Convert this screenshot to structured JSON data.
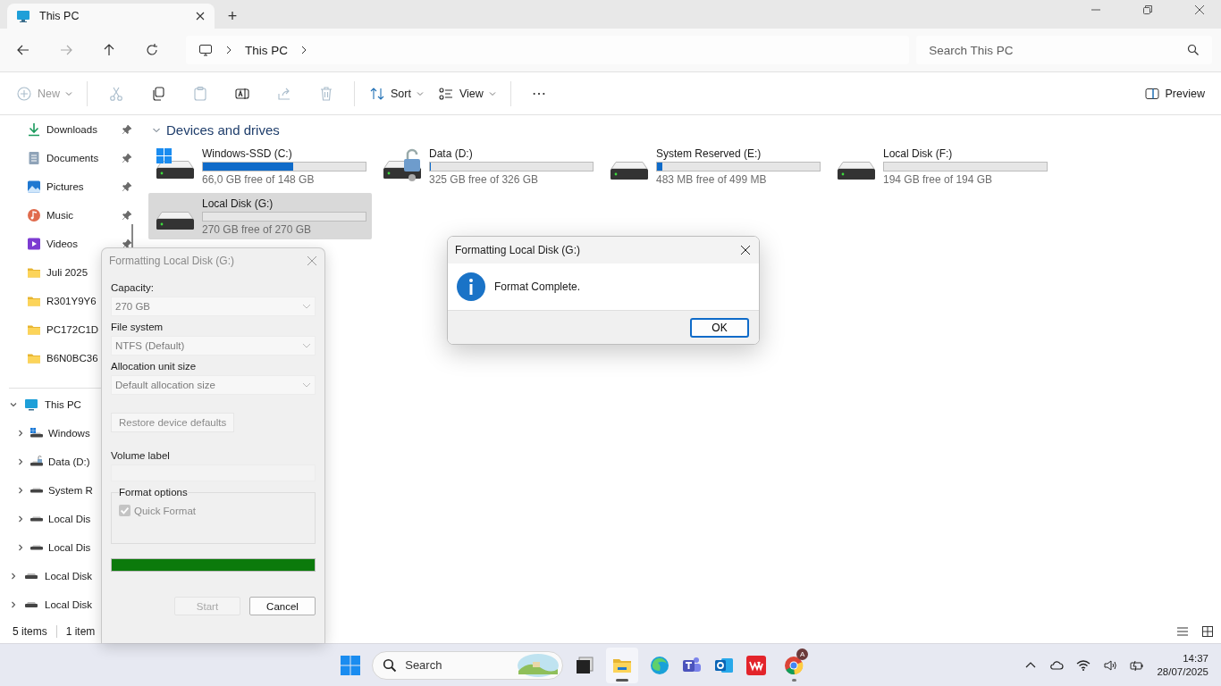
{
  "window": {
    "tab_title": "This PC",
    "new_tab": "+"
  },
  "nav": {
    "breadcrumb": [
      "This PC"
    ],
    "search": {
      "placeholder": "Search This PC"
    }
  },
  "toolbar": {
    "items": [
      {
        "kind": "new",
        "label": "New",
        "disabled": true
      },
      {
        "kind": "cut",
        "disabled": true
      },
      {
        "kind": "copy",
        "disabled": false
      },
      {
        "kind": "paste",
        "disabled": true
      },
      {
        "kind": "rename",
        "disabled": false
      },
      {
        "kind": "share",
        "disabled": true
      },
      {
        "kind": "delete",
        "disabled": true
      },
      {
        "kind": "sort",
        "label": "Sort",
        "disabled": false
      },
      {
        "kind": "view",
        "label": "View",
        "disabled": false
      },
      {
        "kind": "more",
        "disabled": false
      }
    ],
    "preview": "Preview"
  },
  "sidebar": {
    "quick_access": [
      {
        "kind": "downloads",
        "label": "Downloads",
        "pinned": true
      },
      {
        "kind": "documents",
        "label": "Documents",
        "pinned": true
      },
      {
        "kind": "pictures",
        "label": "Pictures",
        "pinned": true
      },
      {
        "kind": "music",
        "label": "Music",
        "pinned": true
      },
      {
        "kind": "videos",
        "label": "Videos",
        "pinned": true
      },
      {
        "kind": "folder",
        "label": "Juli 2025"
      },
      {
        "kind": "folder",
        "label": "R301Y9Y6"
      },
      {
        "kind": "folder",
        "label": "PC172C1D"
      },
      {
        "kind": "folder",
        "label": "B6N0BC36"
      }
    ],
    "tree": [
      {
        "kind": "pc",
        "label": "This PC",
        "expanded": true,
        "children": [
          {
            "kind": "windows-drive",
            "label": "Windows",
            "expanded": false
          },
          {
            "kind": "locked-drive",
            "label": "Data (D:)",
            "expanded": false
          },
          {
            "kind": "drive",
            "label": "System R",
            "expanded": false
          },
          {
            "kind": "drive",
            "label": "Local Dis",
            "expanded": false
          },
          {
            "kind": "drive",
            "label": "Local Dis",
            "expanded": false
          }
        ]
      },
      {
        "kind": "drive",
        "label": "Local Disk",
        "expanded": false
      },
      {
        "kind": "drive",
        "label": "Local Disk",
        "expanded": false
      }
    ]
  },
  "content": {
    "group": {
      "title": "Devices and drives",
      "expanded": true
    },
    "drives": [
      {
        "kind": "windows",
        "name": "Windows-SSD (C:)",
        "level": 0.554,
        "free": "66,0 GB free of 148 GB",
        "selected": false
      },
      {
        "kind": "locked",
        "name": "Data (D:)",
        "level": 0.003,
        "free": "325 GB free of 326 GB",
        "selected": false
      },
      {
        "kind": "plain",
        "name": "System Reserved (E:)",
        "level": 0.032,
        "free": "483 MB free of 499 MB",
        "selected": false
      },
      {
        "kind": "plain",
        "name": "Local Disk (F:)",
        "level": 0,
        "free": "194 GB free of 194 GB",
        "selected": false
      },
      {
        "kind": "plain",
        "name": "Local Disk (G:)",
        "level": 0,
        "free": "270 GB free of 270 GB",
        "selected": true
      }
    ]
  },
  "status_bar": {
    "count": "5 items",
    "selection": "1 item"
  },
  "format_dialog": {
    "title": "Formatting Local Disk (G:)",
    "fields": [
      {
        "label": "Capacity:",
        "value": "270 GB"
      },
      {
        "label": "File system",
        "value": "NTFS (Default)"
      },
      {
        "label": "Allocation unit size",
        "value": "Default allocation size"
      }
    ],
    "restore_button": "Restore device defaults",
    "volume_label": {
      "label": "Volume label"
    },
    "options_title": "Format options",
    "quick_format": {
      "label": "Quick Format",
      "checked": true,
      "disabled": true
    },
    "progress": {
      "level": 1
    },
    "start_button": {
      "label": "Start",
      "disabled": true
    },
    "cancel_button": {
      "label": "Cancel",
      "disabled": false
    }
  },
  "message_box": {
    "title": "Formatting Local Disk (G:)",
    "message": "Format Complete.",
    "ok_button": "OK"
  },
  "taskbar": {
    "search": {
      "placeholder": "Search"
    },
    "chrome_badge": "A",
    "time": "14:37",
    "date": "28/07/2025"
  }
}
